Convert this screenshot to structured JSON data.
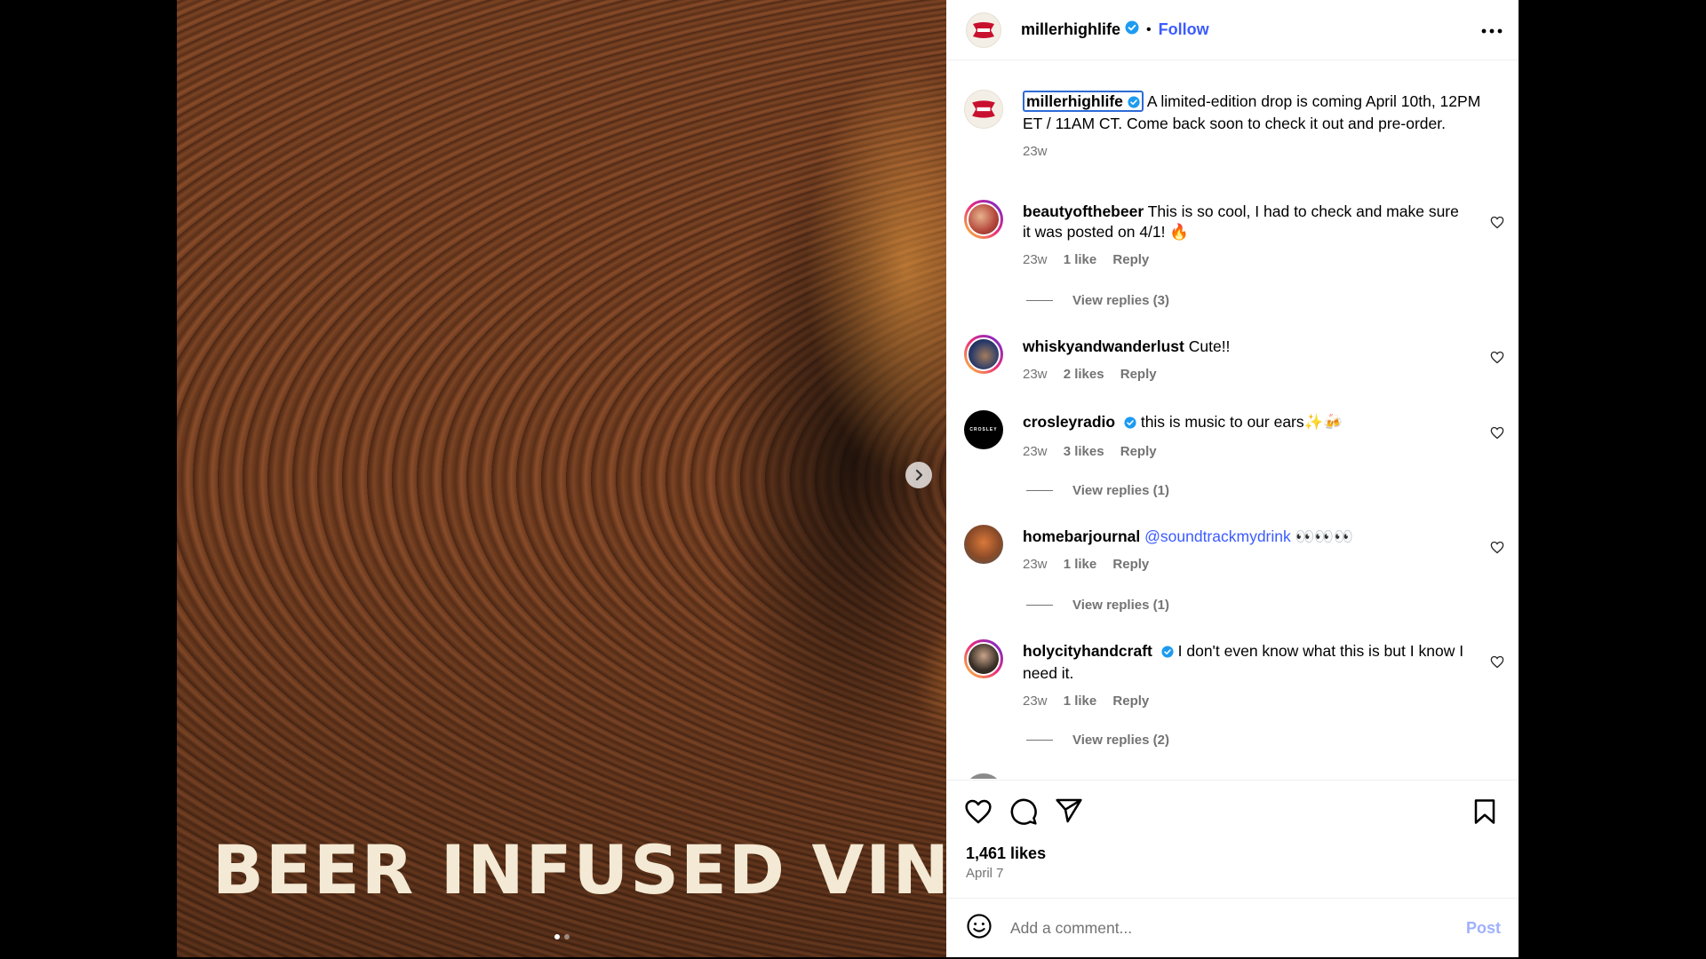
{
  "media": {
    "caption": "BEER INFUSED VINYL ...",
    "slide_count": 2,
    "active_slide": 1
  },
  "header": {
    "username": "millerhighlife",
    "separator": "•",
    "follow_label": "Follow"
  },
  "caption": {
    "username": "millerhighlife",
    "text": "A limited-edition drop is coming April 10th, 12PM ET / 11AM CT. Come back soon to check it out and pre-order.",
    "time": "23w"
  },
  "comments": [
    {
      "username": "beautyofthebeer",
      "text": "This is so cool, I had to check and make sure it was posted on 4/1! 🔥",
      "time": "23w",
      "likes": "1 like",
      "reply": "Reply",
      "view_replies": "View replies (3)"
    },
    {
      "username": "whiskyandwanderlust",
      "text": "Cute!!",
      "time": "23w",
      "likes": "2 likes",
      "reply": "Reply"
    },
    {
      "username": "crosleyradio",
      "text": "this is music to our ears✨🍻",
      "time": "23w",
      "likes": "3 likes",
      "reply": "Reply",
      "view_replies": "View replies (1)",
      "avatar_text": "CROSLEY"
    },
    {
      "username": "homebarjournal",
      "mention": "@soundtrackmydrink",
      "text": "👀👀👀",
      "time": "23w",
      "likes": "1 like",
      "reply": "Reply",
      "view_replies": "View replies (1)"
    },
    {
      "username": "holycityhandcraft",
      "text": "I don't even know what this is but I know I need it.",
      "time": "23w",
      "likes": "1 like",
      "reply": "Reply",
      "view_replies": "View replies (2)"
    }
  ],
  "footer": {
    "likes": "1,461 likes",
    "date": "April 7",
    "comment_placeholder": "Add a comment...",
    "post_label": "Post"
  },
  "colors": {
    "accent": "#3b5bff",
    "verified": "#1d9bf0",
    "muted": "#737373"
  }
}
